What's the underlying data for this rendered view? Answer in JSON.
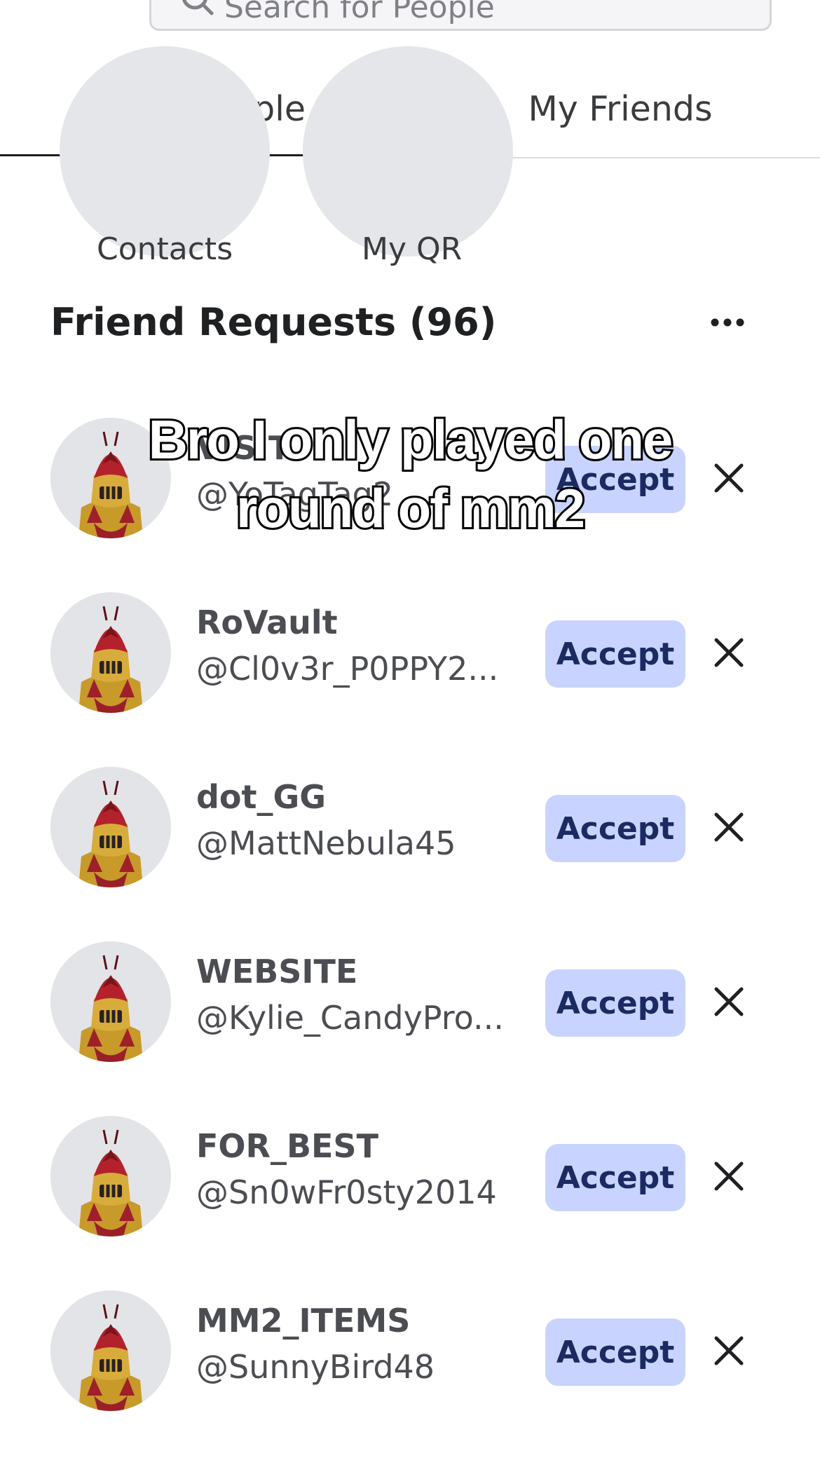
{
  "search": {
    "placeholder": "Search for People"
  },
  "tabs": [
    {
      "label": "Find people",
      "active": true
    },
    {
      "label": "My Friends",
      "active": false
    }
  ],
  "quick_actions": [
    {
      "label": "Contacts"
    },
    {
      "label": "My QR"
    }
  ],
  "friend_requests": {
    "title": "Friend Requests (96)",
    "accept_label": "Accept",
    "items": [
      {
        "display_name": "VISIT",
        "username": "@YoTagTag2"
      },
      {
        "display_name": "RoVault",
        "username": "@Cl0v3r_P0PPY2..."
      },
      {
        "display_name": "dot_GG",
        "username": "@MattNebula45"
      },
      {
        "display_name": "WEBSITE",
        "username": "@Kylie_CandyPro..."
      },
      {
        "display_name": "FOR_BEST",
        "username": "@Sn0wFr0sty2014"
      },
      {
        "display_name": "MM2_ITEMS",
        "username": "@SunnyBird48"
      }
    ]
  },
  "overlay_caption": {
    "line1": "Bro I only played one",
    "line2": "round of mm2"
  },
  "colors": {
    "accept_bg": "#c8d4ff",
    "accept_text": "#1c2a62",
    "avatar_bg": "#e3e4e8"
  }
}
